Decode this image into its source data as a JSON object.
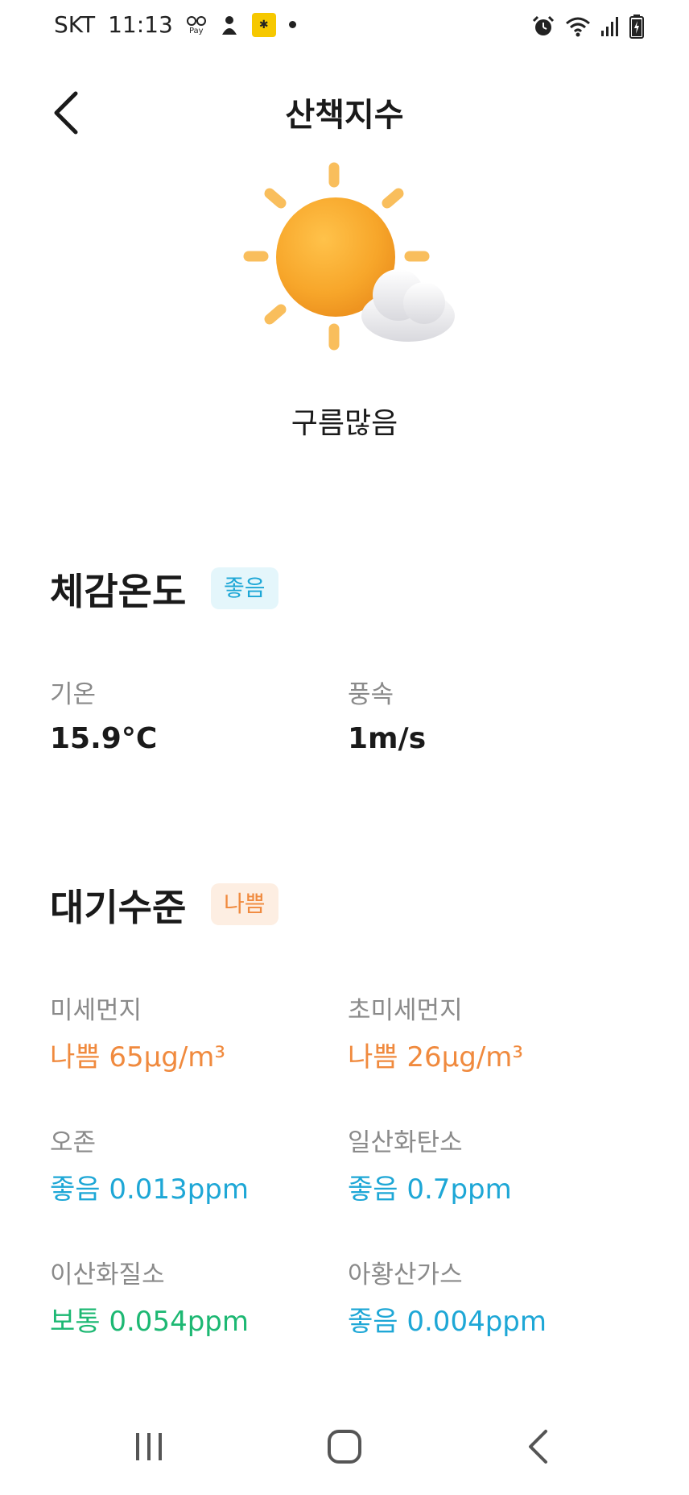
{
  "status_bar": {
    "carrier": "SKT",
    "time": "11:13",
    "pay_label": "Pay"
  },
  "header": {
    "title": "산책지수"
  },
  "weather": {
    "icon": "sun-cloud-icon",
    "condition": "구름많음"
  },
  "feels_like": {
    "title": "체감온도",
    "badge": "좋음",
    "temperature_label": "기온",
    "temperature_value": "15.9°C",
    "wind_label": "풍속",
    "wind_value": "1m/s"
  },
  "air_quality": {
    "title": "대기수준",
    "badge": "나쁨",
    "items": [
      {
        "label": "미세먼지",
        "value": "나쁨 65μg/m³"
      },
      {
        "label": "초미세먼지",
        "value": "나쁨 26μg/m³"
      },
      {
        "label": "오존",
        "value": "좋음 0.013ppm"
      },
      {
        "label": "일산화탄소",
        "value": "좋음 0.7ppm"
      },
      {
        "label": "이산화질소",
        "value": "보통 0.054ppm"
      },
      {
        "label": "아황산가스",
        "value": "좋음 0.004ppm"
      }
    ]
  },
  "colors": {
    "good": "#1ea7d6",
    "bad": "#f08a3e",
    "normal": "#1db873"
  }
}
